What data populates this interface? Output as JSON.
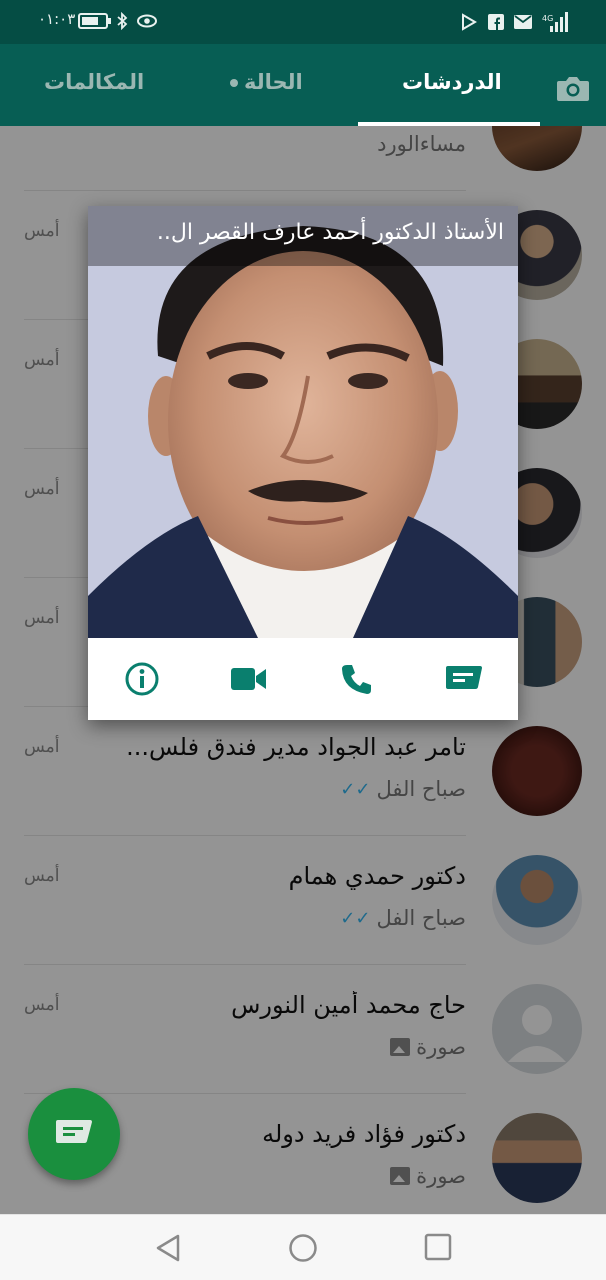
{
  "status_bar": {
    "time": "٠١:٠٣",
    "battery_level": 0.6,
    "icons": [
      "battery-icon",
      "bluetooth-icon",
      "eye-icon",
      "play-store-icon",
      "facebook-icon",
      "mail-icon",
      "signal-icon"
    ],
    "network_label": "4G"
  },
  "tabs": {
    "chats": "الدردشات",
    "status": "الحالة",
    "calls": "المكالمات",
    "selected": "chats"
  },
  "popup": {
    "title": "الأستاذ الدكتور أحمد عارف القصر ال..",
    "actions": [
      "message-icon",
      "call-icon",
      "video-call-icon",
      "info-icon"
    ]
  },
  "chats": [
    {
      "name": "",
      "preview": "مساءالورد",
      "time": "",
      "receipt": "none"
    },
    {
      "name": "..",
      "preview": "",
      "time": "أمس",
      "receipt": "none"
    },
    {
      "name": "",
      "preview": "",
      "time": "أمس",
      "receipt": "none"
    },
    {
      "name": "..",
      "preview": "",
      "time": "أمس",
      "receipt": "none"
    },
    {
      "name": "",
      "preview": "... ...",
      "time": "أمس",
      "receipt": "none"
    },
    {
      "name": "تامر عبد الجواد مدير فندق فلس...",
      "preview": "صباح الفل",
      "time": "أمس",
      "receipt": "read"
    },
    {
      "name": "دكتور حمدي همام",
      "preview": "صباح الفل",
      "time": "أمس",
      "receipt": "read"
    },
    {
      "name": "حاج محمد أمين النورس",
      "preview": "صورة",
      "time": "أمس",
      "receipt": "photo"
    },
    {
      "name": "دكتور فؤاد فريد دوله",
      "preview": "صورة",
      "time": "",
      "receipt": "photo"
    }
  ],
  "colors": {
    "header": "#075e54",
    "status_bar": "#054d44",
    "fab": "#1a8f3e",
    "action_icon": "#0a7f6e",
    "read_ticks": "#34b7f1"
  }
}
